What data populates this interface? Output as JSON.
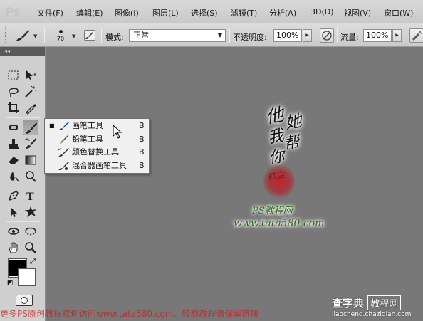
{
  "app": {
    "logo": "Ps"
  },
  "menu": [
    "文件(F)",
    "编辑(E)",
    "图像(I)",
    "图层(L)",
    "选择(S)",
    "滤镜(T)",
    "分析(A)",
    "3D(D)",
    "视图(V)",
    "窗口(W)"
  ],
  "options_bar": {
    "brush_size": "70",
    "mode_label": "模式:",
    "mode_value": "正常",
    "opacity_label": "不透明度:",
    "opacity_value": "100%",
    "flow_label": "流量:",
    "flow_value": "100%"
  },
  "flyout": {
    "items": [
      {
        "label": "画笔工具",
        "shortcut": "B",
        "selected": true,
        "icon": "brush-icon"
      },
      {
        "label": "铅笔工具",
        "shortcut": "B",
        "selected": false,
        "icon": "pencil-icon"
      },
      {
        "label": "颜色替换工具",
        "shortcut": "B",
        "selected": false,
        "icon": "color-replacement-icon"
      },
      {
        "label": "混合器画笔工具",
        "shortcut": "B",
        "selected": false,
        "icon": "mixer-brush-icon"
      }
    ]
  },
  "canvas": {
    "background": "#787878",
    "calligraphy": [
      "他",
      "她",
      "我",
      "帮",
      "你"
    ],
    "seal_text": "红尘",
    "site_name": "PS教程网",
    "site_url": "www.tata580.com"
  },
  "watermarks": {
    "bottom": "更多PS原创教程欢迎访问www.tata580.com，转载教程请保留链接",
    "brand": "查字典",
    "brand_box": "教程网",
    "brand_url": "jiaocheng.chazidian.com"
  },
  "colors": {
    "foreground": "#000000",
    "background": "#ffffff",
    "accent_red": "#c8191d",
    "site_green": "#2a6a14"
  }
}
